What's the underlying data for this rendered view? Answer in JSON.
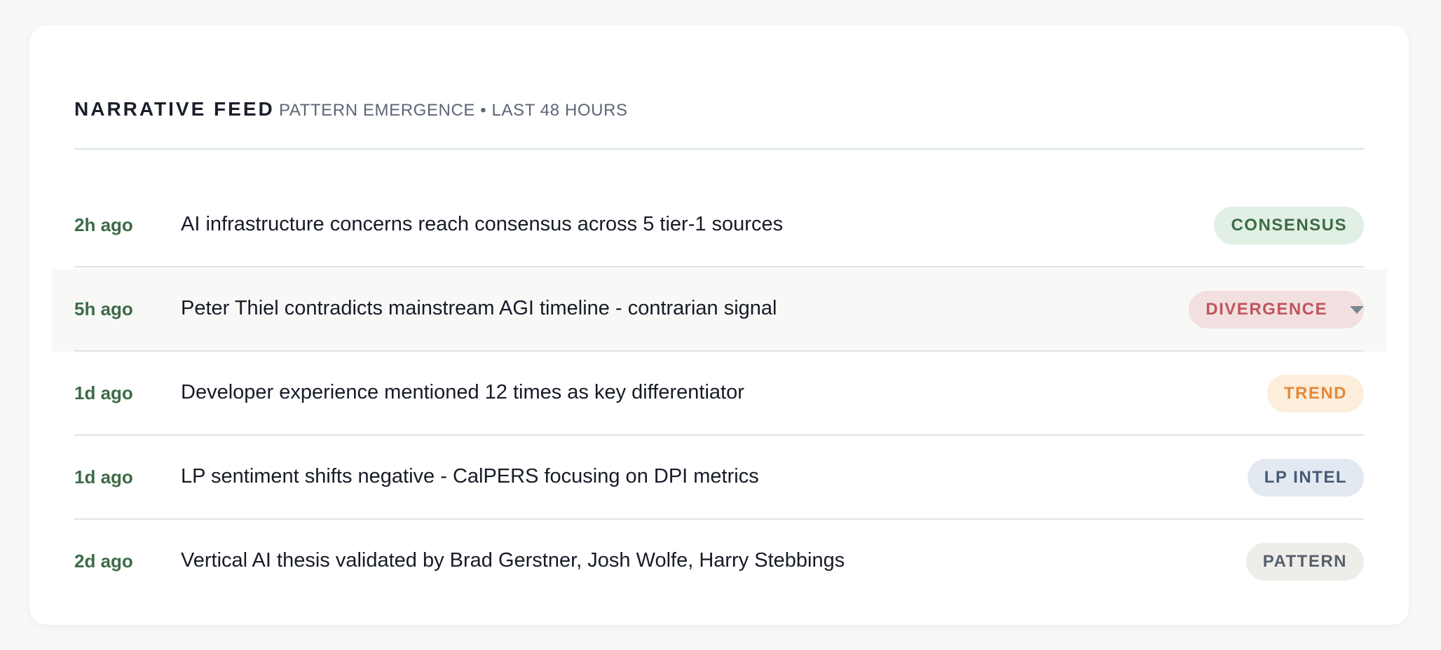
{
  "header": {
    "title": "NARRATIVE FEED",
    "subtitle": "PATTERN EMERGENCE • LAST 48 HOURS"
  },
  "colors": {
    "time_text": "#3e6b47",
    "consensus": "#3c6b45",
    "divergence": "#c0555d",
    "trend": "#e4893a",
    "lp_intel": "#465a77",
    "pattern": "#565f6b"
  },
  "feed": {
    "items": [
      {
        "time": "2h ago",
        "text": "AI infrastructure concerns reach consensus across 5 tier-1 sources",
        "tag": "CONSENSUS"
      },
      {
        "time": "5h ago",
        "text": "Peter Thiel contradicts mainstream AGI timeline - contrarian signal",
        "tag": "DIVERGENCE",
        "tag_icon": "caret-down-icon"
      },
      {
        "time": "1d ago",
        "text": "Developer experience mentioned 12 times as key differentiator",
        "tag": "TREND"
      },
      {
        "time": "1d ago",
        "text": "LP sentiment shifts negative - CalPERS focusing on DPI metrics",
        "tag": "LP INTEL"
      },
      {
        "time": "2d ago",
        "text": "Vertical AI thesis validated by Brad Gerstner, Josh Wolfe, Harry Stebbings",
        "tag": "PATTERN"
      }
    ]
  }
}
